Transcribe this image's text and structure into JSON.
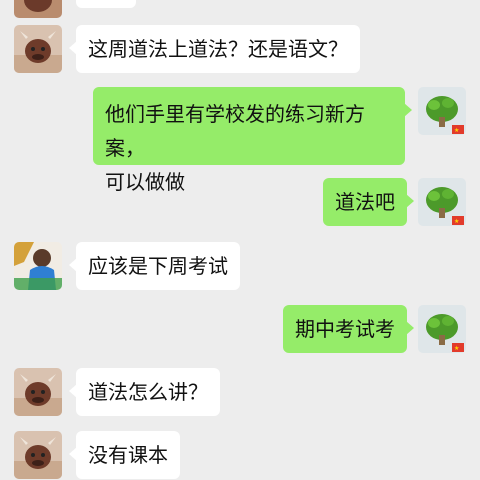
{
  "colors": {
    "background": "#ededed",
    "incoming": "#ffffff",
    "outgoing": "#95ec69"
  },
  "messages": [
    {
      "side": "in",
      "avatar": "cow-avatar",
      "text": "这周道法上道法？还是语文？"
    },
    {
      "side": "out",
      "avatar": "plant-avatar",
      "lines": [
        "他们手里有学校发的练习新方案，",
        "可以做做"
      ]
    },
    {
      "side": "out",
      "avatar": "plant-avatar",
      "text": "道法吧"
    },
    {
      "side": "in",
      "avatar": "person-avatar",
      "text": "应该是下周考试"
    },
    {
      "side": "out",
      "avatar": "plant-avatar",
      "text": "期中考试考"
    },
    {
      "side": "in",
      "avatar": "cow-avatar",
      "text": "道法怎么讲？"
    },
    {
      "side": "in",
      "avatar": "cow-avatar",
      "text": "没有课本"
    }
  ]
}
